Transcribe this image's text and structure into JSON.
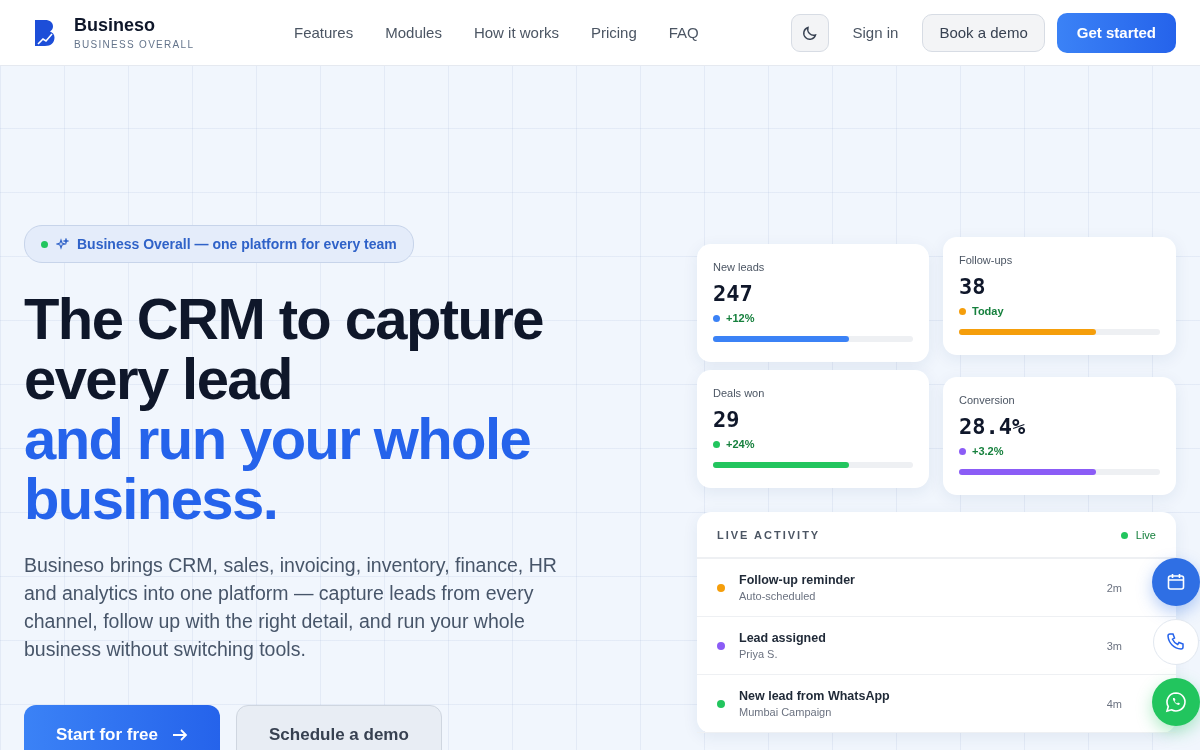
{
  "brand": {
    "name": "Busineso",
    "tagline": "BUSINESS OVERALL"
  },
  "nav": [
    "Features",
    "Modules",
    "How it works",
    "Pricing",
    "FAQ"
  ],
  "header_actions": {
    "sign_in": "Sign in",
    "demo": "Book a demo",
    "start": "Get started"
  },
  "hero": {
    "badge": {
      "text": "Business Overall — one platform for every team",
      "color": "#22c55e"
    },
    "headline": [
      {
        "text": "The CRM to capture",
        "accent": false
      },
      {
        "text": "every lead",
        "accent": false
      },
      {
        "text": "and run your whole",
        "accent": true
      },
      {
        "text": "business.",
        "accent": true
      }
    ],
    "description": "Busineso brings CRM, sales, invoicing, inventory, finance, HR and analytics into one platform — capture leads from every channel, follow up with the right detail, and run your whole business without switching tools.",
    "buttons": [
      {
        "label": "Start for free",
        "kind": "primary"
      },
      {
        "label": "Schedule a demo",
        "kind": "secondary"
      }
    ]
  },
  "stats": [
    {
      "label": "New leads",
      "value": "247",
      "delta": "+12%",
      "color": "#3b82f6",
      "level": 0.68
    },
    {
      "label": "Follow-ups",
      "value": "38",
      "delta": "Today",
      "color": "#f59e0b",
      "level": 0.68
    },
    {
      "label": "Deals won",
      "value": "29",
      "delta": "+24%",
      "color": "#22c55e",
      "level": 0.68
    },
    {
      "label": "Conversion",
      "value": "28.4%",
      "delta": "+3.2%",
      "color": "#8b5cf6",
      "level": 0.68
    }
  ],
  "activity": {
    "title": "LIVE ACTIVITY",
    "status": {
      "text": "Live",
      "color": "#22c55e"
    },
    "items": [
      {
        "title": "Follow-up reminder",
        "subtitle": "Auto-scheduled",
        "time": "2m",
        "color": "#f59e0b"
      },
      {
        "title": "Lead assigned",
        "subtitle": "Priya S.",
        "time": "3m",
        "color": "#8b5cf6"
      },
      {
        "title": "New lead from WhatsApp",
        "subtitle": "Mumbai Campaign",
        "time": "4m",
        "color": "#22c55e"
      }
    ]
  }
}
